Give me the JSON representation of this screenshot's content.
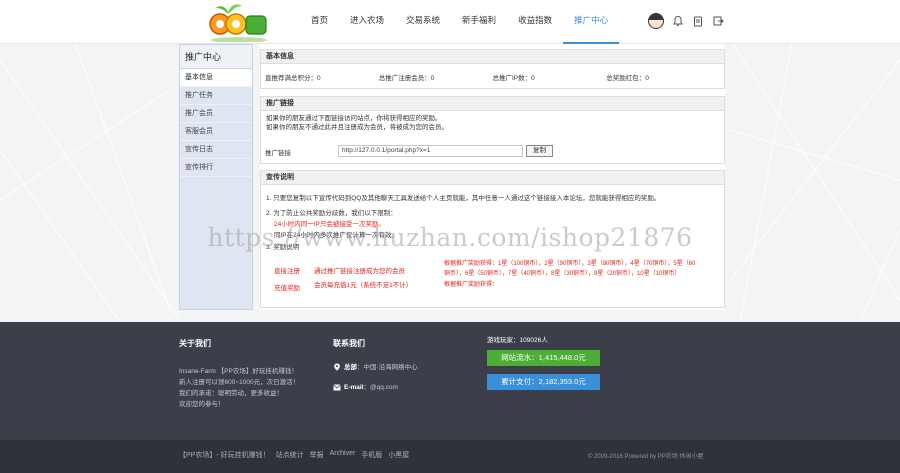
{
  "site": {
    "logo_text": "QQ农场"
  },
  "nav": {
    "items": [
      "首页",
      "进入农场",
      "交易系统",
      "新手福利",
      "收益指数",
      "推广中心"
    ],
    "active_index": 5
  },
  "header_icons": [
    "avatar",
    "bell-icon",
    "clipboard-icon",
    "logout-icon"
  ],
  "sidebar": {
    "title": "推广中心",
    "items": [
      "基本信息",
      "推广任务",
      "推广会员",
      "客服会员",
      "宣传日志",
      "宣传排行"
    ],
    "active_index": 0
  },
  "panels": {
    "basic": {
      "title": "基本信息",
      "stats": [
        "直推荐满总积分：0",
        "总推广注册会员：0",
        "总推广IP数：0",
        "总奖励红包：0"
      ]
    },
    "link": {
      "title": "推广链接",
      "line1": "如果你的朋友通过下面链接访问站点，你将获得相应的奖励。",
      "line2": "如果你的朋友不通过此并且注册成为会员，将被成为您的会员。",
      "label": "推广链接",
      "url": "http://127.0.0.1/portal.php?x=1",
      "copy_button": "复制"
    },
    "promo": {
      "title": "宣传说明",
      "line1": "1. 只要您复制以下宣传代码到QQ及其他聊天工具发送给个人主页就能，其中任意一人通过这个链接接入本论坛，您就能获得相应的奖励。",
      "line2": "2. 为了防止公共奖励分歧数，我们以下限制：",
      "line2a": "24小时内同一IP只会被接受一次奖励。",
      "line2b": "同IP在24小时内多次推广仅计算一次有效。",
      "line3": "3. 奖励说明",
      "reward_rows": [
        {
          "label": "直接注册",
          "desc": "通过推广链接注册成为您的会员",
          "detail1": "根据推广奖励获得：1星（100铜币），2星（90铜币），3星（80铜币），4星（70铜币），5星（60",
          "detail2": "铜币），6星（50铜币），7星（40铜币），8星（30铜币），9星（20铜币），10星（10铜币）"
        },
        {
          "label": "充值奖励",
          "desc": "会员每充值1元（系统不足1不计）",
          "detail1": "根据推广奖励获得：",
          "detail2": ""
        }
      ]
    }
  },
  "watermark": "https://www.huzhan.com/ishop21876",
  "footer": {
    "about_title": "关于我们",
    "about_lines": [
      "Insane-Farm 【PP农场】好玩挂机赚钱！",
      "新人注册可以领600~1000元，次日激活！",
      "我们的承诺：聪明劳动，更多收益！",
      "欢迎您的参与！"
    ],
    "contact_title": "联系我们",
    "address_label": "总部",
    "address": "：中国·沿海网络中心",
    "email_label": "E-mail",
    "email": "：@qq.com",
    "players_label": "游戏玩家：",
    "players_value": "109026人",
    "btn_green": "网站流水：1,415,448.0元",
    "btn_blue": "累计支付：2,182,353.0元",
    "bottom_links": [
      "【PP农场】- 好玩挂机赚钱！",
      "站点统计",
      "举报",
      "Archiver",
      "手机版",
      "小黑屋"
    ],
    "copyright": "© 2009-2016 Powered by PP农场 休闲小屋"
  },
  "colors": {
    "accent": "#3a8fd9",
    "green": "#4cae34",
    "blue": "#3a8fd9",
    "footer_bg": "#3c3f4a",
    "red": "#e2231a",
    "orange": "#f39800"
  }
}
